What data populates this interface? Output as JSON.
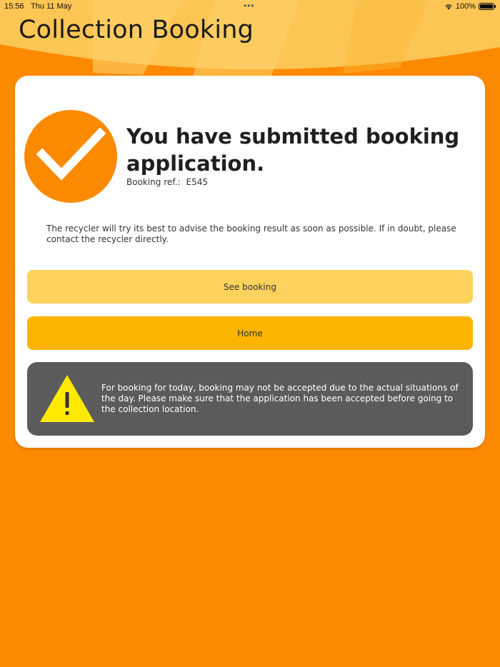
{
  "status_bar": {
    "time": "15:56",
    "date": "Thu 11 May",
    "dots": "•••",
    "battery": "100%"
  },
  "header": {
    "title": "Collection Booking"
  },
  "confirmation": {
    "headline": "You have submitted booking application.",
    "ref_label": "Booking ref.:",
    "ref_value": "E545",
    "info": "The recycler will try its best to advise the booking result as soon as possible. If in doubt, please contact the recycler directly."
  },
  "buttons": {
    "see_booking": "See booking",
    "home": "Home"
  },
  "warning": {
    "text": "For booking for today, booking may not be accepted due to the actual situations of the day. Please make sure that the application has been accepted before going to the collection location.",
    "icon": "warning-triangle-icon"
  },
  "colors": {
    "background": "#FB8A00",
    "header_light": "#FDC553",
    "button_light": "#FDD35D",
    "button_main": "#FCB400",
    "warning_box": "#5B5B5B",
    "warning_icon": "#FDEA00"
  }
}
